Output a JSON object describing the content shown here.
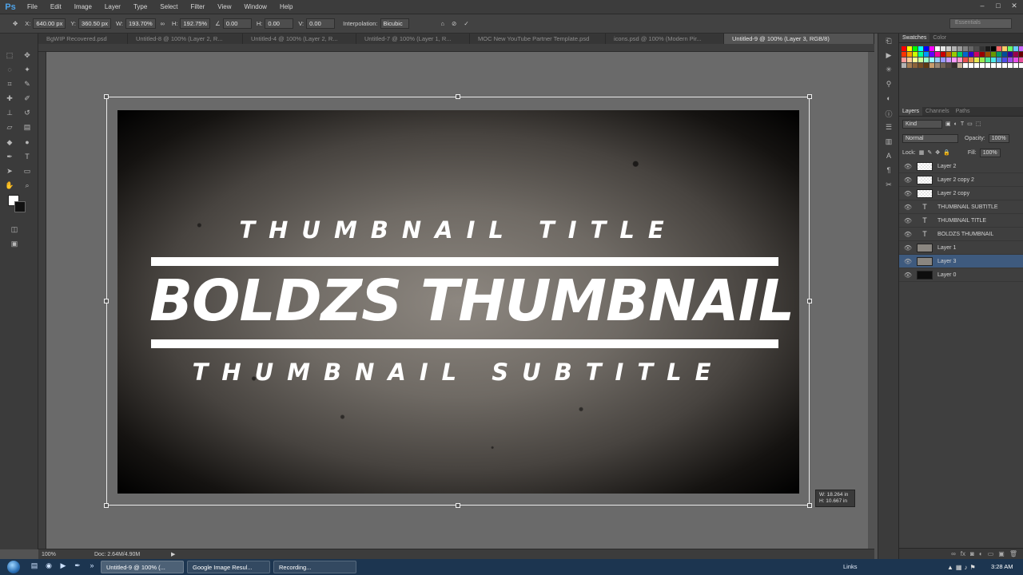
{
  "app": {
    "logo": "Ps",
    "menu": [
      "File",
      "Edit",
      "Image",
      "Layer",
      "Type",
      "Select",
      "Filter",
      "View",
      "Window",
      "Help"
    ],
    "window_controls": [
      "–",
      "□",
      "✕"
    ]
  },
  "options": {
    "x_label": "X:",
    "x_value": "640.00 px",
    "y_label": "Y:",
    "y_value": "360.50 px",
    "w_label": "W:",
    "w_value": "193.70%",
    "h_label": "H:",
    "h_value": "192.75%",
    "angle_value": "0.00",
    "hskew_label": "H:",
    "hskew_value": "0.00",
    "vskew_label": "V:",
    "vskew_value": "0.00",
    "interp_label": "Interpolation:",
    "interp_value": "Bicubic",
    "workspace": "Essentials"
  },
  "tabs": [
    {
      "label": "BgWIP Recovered.psd",
      "active": false
    },
    {
      "label": "Untitled-8 @ 100% (Layer 2, R...",
      "active": false
    },
    {
      "label": "Untitled-4 @ 100% (Layer 2, R...",
      "active": false
    },
    {
      "label": "Untitled-7 @ 100% (Layer 1, R...",
      "active": false
    },
    {
      "label": "MOC New YouTube Partner Template.psd",
      "active": false
    },
    {
      "label": "icons.psd @ 100% (Modern Pir...",
      "active": false
    },
    {
      "label": "Untitled-9 @ 100% (Layer 3, RGB/8)",
      "active": true
    }
  ],
  "canvas": {
    "title": "THUMBNAIL TITLE",
    "main": "BOLDZS THUMBNAIL",
    "subtitle": "THUMBNAIL SUBTITLE",
    "size_w": "W: 18.264 in",
    "size_h": "H: 10.667 in"
  },
  "status": {
    "zoom": "100%",
    "doc": "Doc: 2.64M/4.90M",
    "arrow": "▶"
  },
  "panels": {
    "swatch_tabs": [
      "Swatches",
      "Color"
    ],
    "layer_tabs": [
      "Layers",
      "Channels",
      "Paths"
    ],
    "kind": "Kind",
    "blend_mode": "Normal",
    "opacity_label": "Opacity:",
    "opacity_value": "100%",
    "lock_label": "Lock:",
    "fill_label": "Fill:",
    "fill_value": "100%",
    "layers": [
      {
        "name": "Layer 2",
        "thumb": "trans",
        "selected": false
      },
      {
        "name": "Layer 2 copy 2",
        "thumb": "trans",
        "selected": false
      },
      {
        "name": "Layer 2 copy",
        "thumb": "trans",
        "selected": false
      },
      {
        "name": "THUMBNAIL SUBTITLE",
        "thumb": "text",
        "selected": false
      },
      {
        "name": "THUMBNAIL TITLE",
        "thumb": "text",
        "selected": false
      },
      {
        "name": "BOLDZS THUMBNAIL",
        "thumb": "text",
        "selected": false
      },
      {
        "name": "Layer 1",
        "thumb": "tex",
        "selected": false
      },
      {
        "name": "Layer 3",
        "thumb": "tex",
        "selected": true
      },
      {
        "name": "Layer 0",
        "thumb": "blk",
        "selected": false
      }
    ],
    "footer_icons": [
      "link-icon",
      "fx-icon",
      "mask-icon",
      "adjustment-icon",
      "group-icon",
      "new-layer-icon",
      "trash-icon"
    ]
  },
  "swatch_colors": [
    "#ff0000",
    "#ffff00",
    "#00ff00",
    "#00ffff",
    "#0000ff",
    "#ff00ff",
    "#ffffff",
    "#e6e6e6",
    "#cccccc",
    "#b3b3b3",
    "#999999",
    "#808080",
    "#666666",
    "#4d4d4d",
    "#333333",
    "#1a1a1a",
    "#000000",
    "#ff6666",
    "#ffcc66",
    "#66ff66",
    "#66ccff",
    "#cc66ff",
    "#ff3300",
    "#ff9900",
    "#ccff00",
    "#00ff99",
    "#0099ff",
    "#6600ff",
    "#ff0099",
    "#cc0000",
    "#cc6600",
    "#99cc00",
    "#00cc66",
    "#0066cc",
    "#3300cc",
    "#cc0066",
    "#990000",
    "#994d00",
    "#669900",
    "#009966",
    "#004d99",
    "#330099",
    "#99004d",
    "#660000",
    "#ff9999",
    "#ffcc99",
    "#ffff99",
    "#ccff99",
    "#99ffcc",
    "#99ffff",
    "#99ccff",
    "#9999ff",
    "#cc99ff",
    "#ff99ff",
    "#ff99cc",
    "#e64d4d",
    "#e6994d",
    "#e6e64d",
    "#99e64d",
    "#4de699",
    "#4de6e6",
    "#4d99e6",
    "#4d4de6",
    "#994de6",
    "#e64de6",
    "#e64d99",
    "#b3b3b3",
    "#a67c52",
    "#8c6239",
    "#754c24",
    "#603913",
    "#c69c6d",
    "#998675",
    "#736357",
    "#534741",
    "#362f2d",
    "#c7b299",
    "#ffffff",
    "#ffffff",
    "#ffffff",
    "#ffffff",
    "#ffffff",
    "#ffffff",
    "#ffffff",
    "#ffffff",
    "#ffffff",
    "#ffffff",
    "#ffffff"
  ],
  "taskbar": {
    "tasks": [
      {
        "label": "Untitled-9 @ 100% (...",
        "icon": "photoshop-icon",
        "active": true
      },
      {
        "label": "Google Image Resul...",
        "icon": "chrome-icon",
        "active": false
      },
      {
        "label": "Recording...",
        "icon": "recording-icon",
        "active": false
      }
    ],
    "links": "Links",
    "time": "3:28 AM"
  }
}
